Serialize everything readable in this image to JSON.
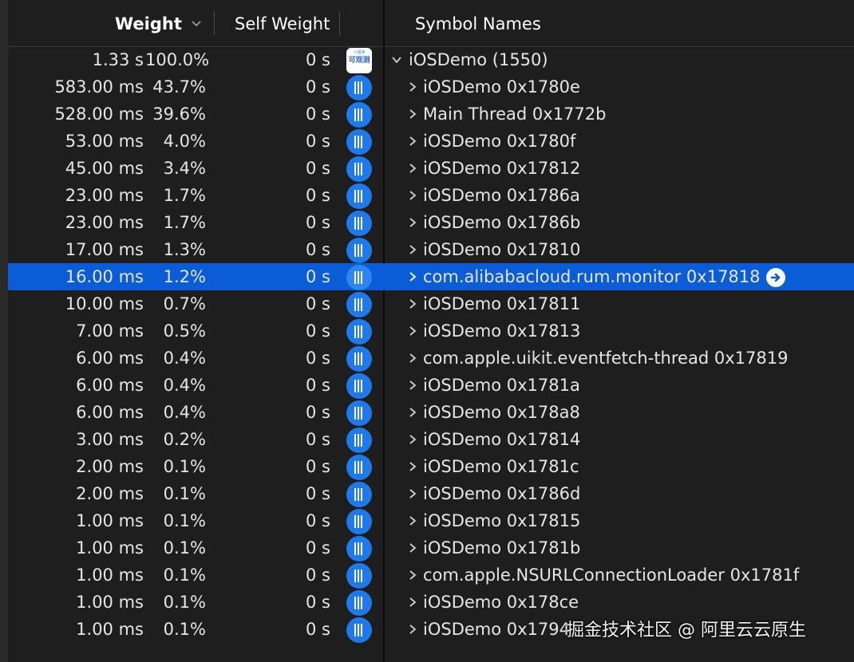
{
  "header": {
    "weight_label": "Weight",
    "self_weight_label": "Self Weight",
    "symbol_names_label": "Symbol Names"
  },
  "app_icon": {
    "tiny_text": "小程序",
    "label": "可观测"
  },
  "rows": [
    {
      "weight": "1.33 s",
      "percent": "100.0%",
      "self": "0 s",
      "symbol": "iOSDemo (1550)"
    },
    {
      "weight": "583.00 ms",
      "percent": "43.7%",
      "self": "0 s",
      "symbol": "iOSDemo 0x1780e"
    },
    {
      "weight": "528.00 ms",
      "percent": "39.6%",
      "self": "0 s",
      "symbol": "Main Thread 0x1772b"
    },
    {
      "weight": "53.00 ms",
      "percent": "4.0%",
      "self": "0 s",
      "symbol": "iOSDemo 0x1780f"
    },
    {
      "weight": "45.00 ms",
      "percent": "3.4%",
      "self": "0 s",
      "symbol": "iOSDemo 0x17812"
    },
    {
      "weight": "23.00 ms",
      "percent": "1.7%",
      "self": "0 s",
      "symbol": "iOSDemo 0x1786a"
    },
    {
      "weight": "23.00 ms",
      "percent": "1.7%",
      "self": "0 s",
      "symbol": "iOSDemo 0x1786b"
    },
    {
      "weight": "17.00 ms",
      "percent": "1.3%",
      "self": "0 s",
      "symbol": "iOSDemo 0x17810"
    },
    {
      "weight": "16.00 ms",
      "percent": "1.2%",
      "self": "0 s",
      "symbol": "com.alibabacloud.rum.monitor 0x17818"
    },
    {
      "weight": "10.00 ms",
      "percent": "0.7%",
      "self": "0 s",
      "symbol": "iOSDemo 0x17811"
    },
    {
      "weight": "7.00 ms",
      "percent": "0.5%",
      "self": "0 s",
      "symbol": "iOSDemo 0x17813"
    },
    {
      "weight": "6.00 ms",
      "percent": "0.4%",
      "self": "0 s",
      "symbol": "com.apple.uikit.eventfetch-thread 0x17819"
    },
    {
      "weight": "6.00 ms",
      "percent": "0.4%",
      "self": "0 s",
      "symbol": "iOSDemo 0x1781a"
    },
    {
      "weight": "6.00 ms",
      "percent": "0.4%",
      "self": "0 s",
      "symbol": "iOSDemo 0x178a8"
    },
    {
      "weight": "3.00 ms",
      "percent": "0.2%",
      "self": "0 s",
      "symbol": "iOSDemo 0x17814"
    },
    {
      "weight": "2.00 ms",
      "percent": "0.1%",
      "self": "0 s",
      "symbol": "iOSDemo 0x1781c"
    },
    {
      "weight": "2.00 ms",
      "percent": "0.1%",
      "self": "0 s",
      "symbol": "iOSDemo 0x1786d"
    },
    {
      "weight": "1.00 ms",
      "percent": "0.1%",
      "self": "0 s",
      "symbol": "iOSDemo 0x17815"
    },
    {
      "weight": "1.00 ms",
      "percent": "0.1%",
      "self": "0 s",
      "symbol": "iOSDemo 0x1781b"
    },
    {
      "weight": "1.00 ms",
      "percent": "0.1%",
      "self": "0 s",
      "symbol": "com.apple.NSURLConnectionLoader 0x1781f"
    },
    {
      "weight": "1.00 ms",
      "percent": "0.1%",
      "self": "0 s",
      "symbol": "iOSDemo 0x178ce"
    },
    {
      "weight": "1.00 ms",
      "percent": "0.1%",
      "self": "0 s",
      "symbol": "iOSDemo 0x1794"
    }
  ],
  "watermark": "掘金技术社区 @ 阿里云云原生",
  "colors": {
    "selection": "#0a5cd7",
    "thread_icon": "#1e79ea",
    "background": "#1e1e1e"
  }
}
